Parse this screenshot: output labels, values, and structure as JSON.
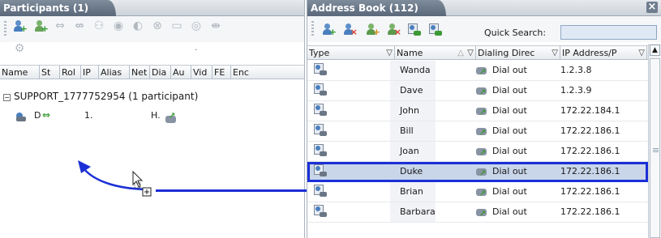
{
  "participants": {
    "title": "Participants (1)",
    "columns": [
      "Name",
      "St",
      "Rol",
      "IP",
      "Alias",
      "Net",
      "Dia",
      "Au",
      "Vid",
      "FE",
      "Enc"
    ],
    "group_label": "SUPPORT_1777752954 (1 participant)",
    "row": {
      "name": "D",
      "ip": "1.",
      "alias": "H."
    },
    "toolbar_dot": "."
  },
  "address_book": {
    "title": "Address Book (112)",
    "close_glyph": "×",
    "quick_search_label": "Quick Search:",
    "quick_search_value": "",
    "columns": [
      "Type",
      "Name",
      "Dialing Direc",
      "IP Address/P"
    ],
    "rows": [
      {
        "name": "Wanda",
        "direction": "Dial out",
        "ip": "1.2.3.8"
      },
      {
        "name": "Dave",
        "direction": "Dial out",
        "ip": "1.2.3.9"
      },
      {
        "name": "John",
        "direction": "Dial out",
        "ip": "172.22.184.1"
      },
      {
        "name": "Bill",
        "direction": "Dial out",
        "ip": "172.22.186.1"
      },
      {
        "name": "Joan",
        "direction": "Dial out",
        "ip": "172.22.186.1"
      },
      {
        "name": "Duke",
        "direction": "Dial out",
        "ip": "172.22.186.1",
        "selected": true
      },
      {
        "name": "Brian",
        "direction": "Dial out",
        "ip": "172.22.186.1"
      },
      {
        "name": "Barbara",
        "direction": "Dial out",
        "ip": "172.22.186.1"
      }
    ]
  },
  "colors": {
    "highlight": "#1b2fd6",
    "selected_row": "#c9d6ea",
    "title_tab": "#59677a"
  },
  "icons": {
    "participants_toolbar": [
      "add-participant-icon",
      "add-from-list-icon",
      "connect-icon",
      "disconnect-icon",
      "delete-participant-icon",
      "mute-audio-icon",
      "block-audio-icon",
      "suspend-video-icon",
      "video-icon",
      "signal-icon",
      "conference-link-icon",
      "settings-icon"
    ],
    "address_book_toolbar": [
      "new-participant-icon",
      "delete-participant-icon",
      "new-group-icon",
      "delete-group-icon",
      "participant-properties-icon",
      "group-properties-icon"
    ]
  }
}
